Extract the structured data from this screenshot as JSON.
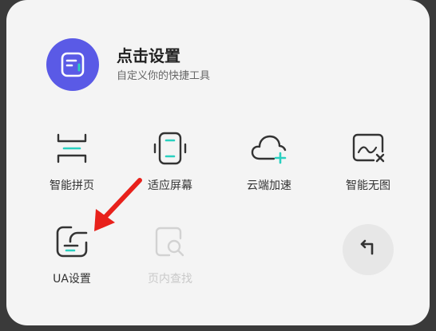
{
  "header": {
    "title": "点击设置",
    "subtitle": "自定义你的快捷工具",
    "logo_icon": "document-icon",
    "accent": "#5a5ae6",
    "highlight": "#2ad0c0"
  },
  "tools": [
    {
      "label": "智能拼页",
      "icon": "page-join-icon",
      "enabled": true
    },
    {
      "label": "适应屏幕",
      "icon": "fit-screen-icon",
      "enabled": true
    },
    {
      "label": "云端加速",
      "icon": "cloud-accelerate-icon",
      "enabled": true
    },
    {
      "label": "智能无图",
      "icon": "no-image-icon",
      "enabled": true
    },
    {
      "label": "UA设置",
      "icon": "ua-setting-icon",
      "enabled": true
    },
    {
      "label": "页内查找",
      "icon": "find-in-page-icon",
      "enabled": false
    }
  ],
  "back_button": {
    "icon": "return-arrow-icon"
  },
  "annotation": {
    "color": "#e8211b",
    "icon": "red-arrow-pointer"
  }
}
